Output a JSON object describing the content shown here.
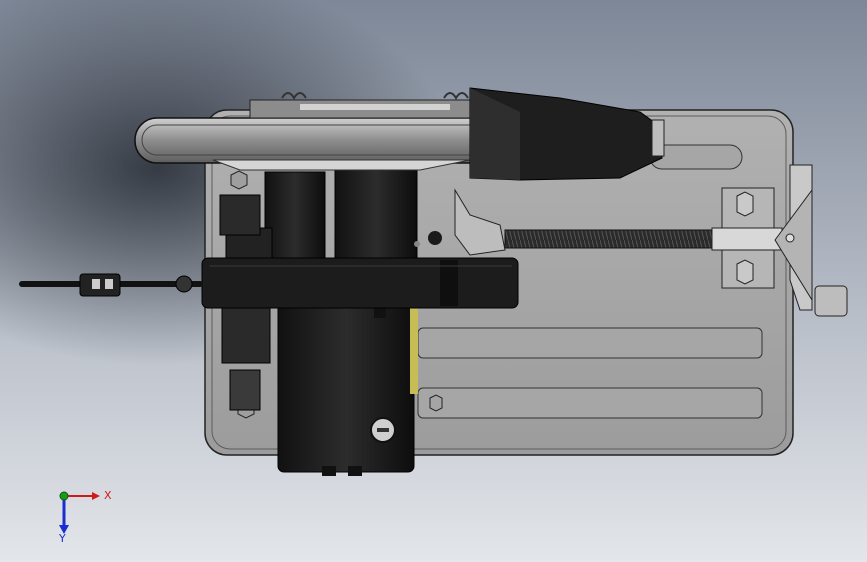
{
  "viewport": {
    "background_top": "#8a93a2",
    "background_bottom": "#d9dde4"
  },
  "model": {
    "part_color": "#9a9a9a",
    "dark_color": "#1e1e1e",
    "plate_color": "#a9a9a9",
    "edge_color": "#222222"
  },
  "triad": {
    "x_label": "X",
    "y_label": "Y",
    "x_color": "#d11a1a",
    "y_color": "#1a2ed1",
    "origin_color": "#1a9a1a"
  }
}
